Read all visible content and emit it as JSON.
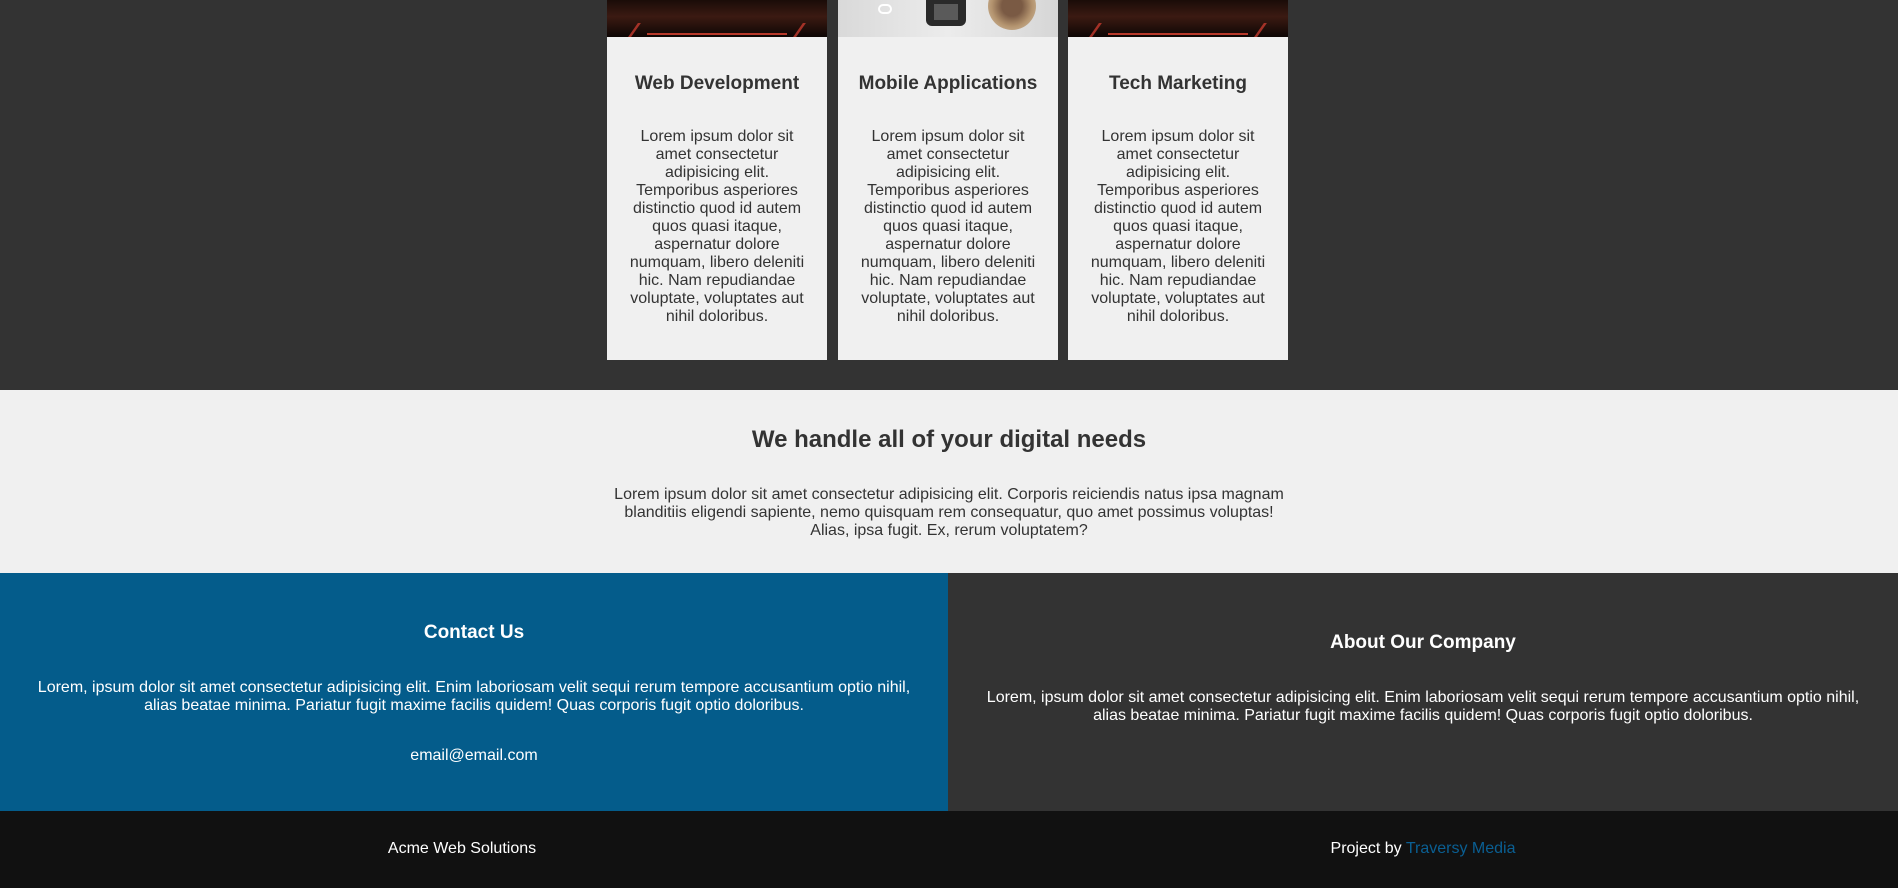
{
  "services": [
    {
      "title": "Web Development",
      "text": "Lorem ipsum dolor sit amet consectetur adipisicing elit. Temporibus asperiores distinctio quod id autem quos quasi itaque, aspernatur dolore numquam, libero deleniti hic. Nam repudiandae voluptate, voluptates aut nihil doloribus."
    },
    {
      "title": "Mobile Applications",
      "text": "Lorem ipsum dolor sit amet consectetur adipisicing elit. Temporibus asperiores distinctio quod id autem quos quasi itaque, aspernatur dolore numquam, libero deleniti hic. Nam repudiandae voluptate, voluptates aut nihil doloribus."
    },
    {
      "title": "Tech Marketing",
      "text": "Lorem ipsum dolor sit amet consectetur adipisicing elit. Temporibus asperiores distinctio quod id autem quos quasi itaque, aspernatur dolore numquam, libero deleniti hic. Nam repudiandae voluptate, voluptates aut nihil doloribus."
    }
  ],
  "needs": {
    "title": "We handle all of your digital needs",
    "text": "Lorem ipsum dolor sit amet consectetur adipisicing elit. Corporis reiciendis natus ipsa magnam blanditiis eligendi sapiente, nemo quisquam rem consequatur, quo amet possimus voluptas! Alias, ipsa fugit. Ex, rerum voluptatem?"
  },
  "contact": {
    "title": "Contact Us",
    "text": "Lorem, ipsum dolor sit amet consectetur adipisicing elit. Enim laboriosam velit sequi rerum tempore accusantium optio nihil, alias beatae minima. Pariatur fugit maxime facilis quidem! Quas corporis fugit optio doloribus.",
    "email": "email@email.com"
  },
  "about": {
    "title": "About Our Company",
    "text": "Lorem, ipsum dolor sit amet consectetur adipisicing elit. Enim laboriosam velit sequi rerum tempore accusantium optio nihil, alias beatae minima. Pariatur fugit maxime facilis quidem! Quas corporis fugit optio doloribus."
  },
  "footer": {
    "brand": "Acme Web Solutions",
    "credit_prefix": "Project by",
    "credit_link": "Traversy Media"
  },
  "colors": {
    "dark_bg": "#333333",
    "light_bg": "#f0f0f0",
    "primary_blue": "#045c8b",
    "footer_bg": "#111111",
    "link": "#0a5f93"
  }
}
